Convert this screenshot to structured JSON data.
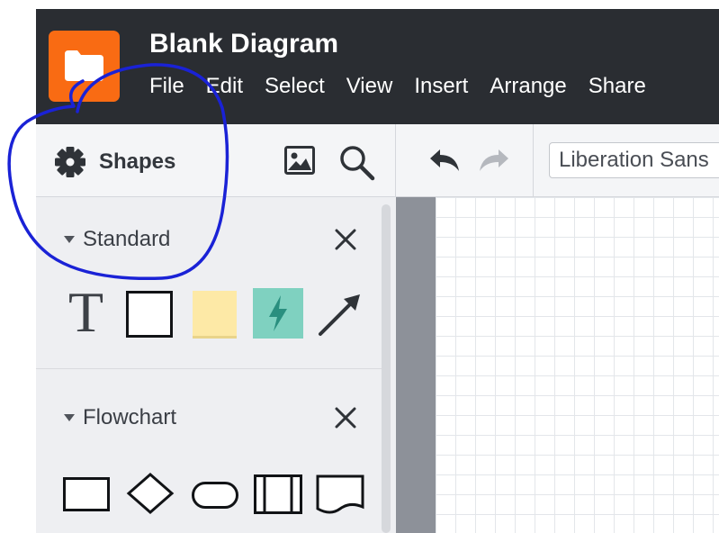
{
  "app": {
    "document_title": "Blank Diagram",
    "menu": [
      "File",
      "Edit",
      "Select",
      "View",
      "Insert",
      "Arrange",
      "Share"
    ]
  },
  "toolbar": {
    "shapes_label": "Shapes",
    "font_value": "Liberation Sans"
  },
  "sidebar": {
    "libraries": [
      {
        "label": "Standard"
      },
      {
        "label": "Flowchart"
      }
    ]
  },
  "shapes": {
    "text_glyph": "T"
  },
  "colors": {
    "brand": "#f96b13",
    "header_bg": "#2a2d32",
    "sticky_note": "#fde9a6",
    "action_shape": "#7fd1c0",
    "annotation": "#1a22d6"
  }
}
